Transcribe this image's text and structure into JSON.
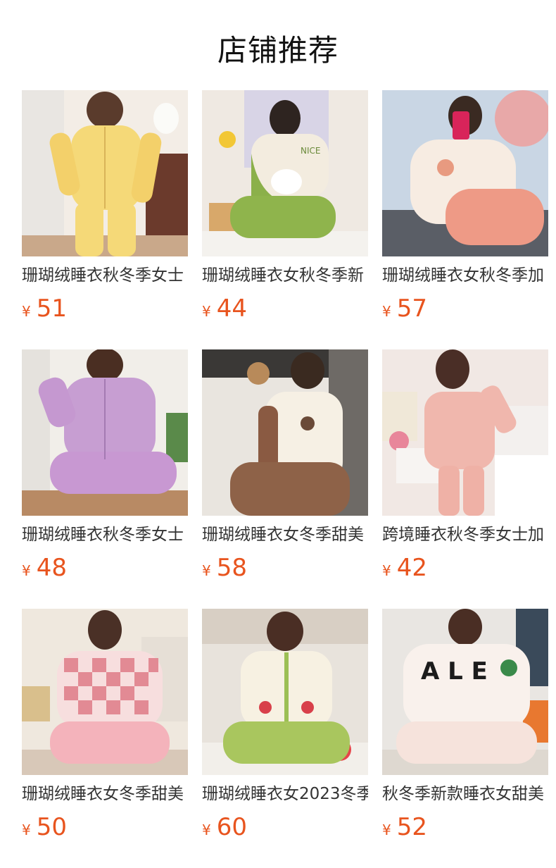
{
  "header": {
    "title": "店铺推荐"
  },
  "products": [
    {
      "name": "珊瑚绒睡衣秋冬季女士",
      "currency": "¥",
      "price": "51",
      "image": "woman-in-yellow-fleece-pajamas"
    },
    {
      "name": "珊瑚绒睡衣女秋冬季新",
      "currency": "¥",
      "price": "44",
      "image": "woman-in-green-duck-fleece-pajamas"
    },
    {
      "name": "珊瑚绒睡衣女秋冬季加",
      "currency": "¥",
      "price": "57",
      "image": "woman-in-cream-pink-bear-pajamas"
    },
    {
      "name": "珊瑚绒睡衣秋冬季女士",
      "currency": "¥",
      "price": "48",
      "image": "woman-in-purple-fleece-pajamas"
    },
    {
      "name": "珊瑚绒睡衣女冬季甜美",
      "currency": "¥",
      "price": "58",
      "image": "woman-in-cream-brown-bear-pajamas"
    },
    {
      "name": "跨境睡衣秋冬季女士加",
      "currency": "¥",
      "price": "42",
      "image": "woman-in-pink-velvet-pajamas"
    },
    {
      "name": "珊瑚绒睡衣女冬季甜美",
      "currency": "¥",
      "price": "50",
      "image": "woman-in-pink-checkered-pajamas"
    },
    {
      "name": "珊瑚绒睡衣女2023冬季",
      "currency": "¥",
      "price": "60",
      "image": "woman-in-green-strawberry-pajamas"
    },
    {
      "name": "秋冬季新款睡衣女甜美",
      "currency": "¥",
      "price": "52",
      "image": "woman-in-white-letter-pajamas"
    }
  ],
  "colors": {
    "price": "#e8541e",
    "title": "#111111",
    "text": "#333333"
  }
}
